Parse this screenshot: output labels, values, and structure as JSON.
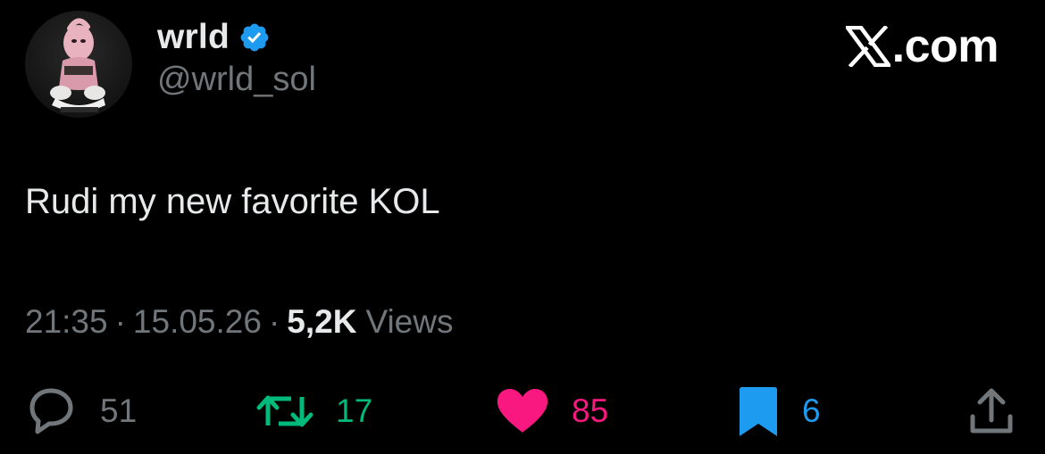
{
  "author": {
    "display_name": "wrld",
    "handle": "@wrld_sol",
    "verified": true,
    "avatar_icon": "pink-cartoon-character-avatar"
  },
  "brand": {
    "logo_icon": "x-logo-icon",
    "site": ".com"
  },
  "tweet": {
    "text": "Rudi my new favorite KOL"
  },
  "meta": {
    "time": "21:35",
    "separator": "·",
    "date": "15.05.26",
    "views_count": "5,2K",
    "views_label": "Views"
  },
  "actions": {
    "replies": "51",
    "reposts": "17",
    "likes": "85",
    "bookmarks": "6"
  },
  "colors": {
    "background": "#000000",
    "text_primary": "#e7e9ea",
    "text_secondary": "#71767b",
    "verified": "#1d9bf0",
    "repost": "#00ba7c",
    "like": "#f91880",
    "bookmark": "#1d9bf0"
  }
}
